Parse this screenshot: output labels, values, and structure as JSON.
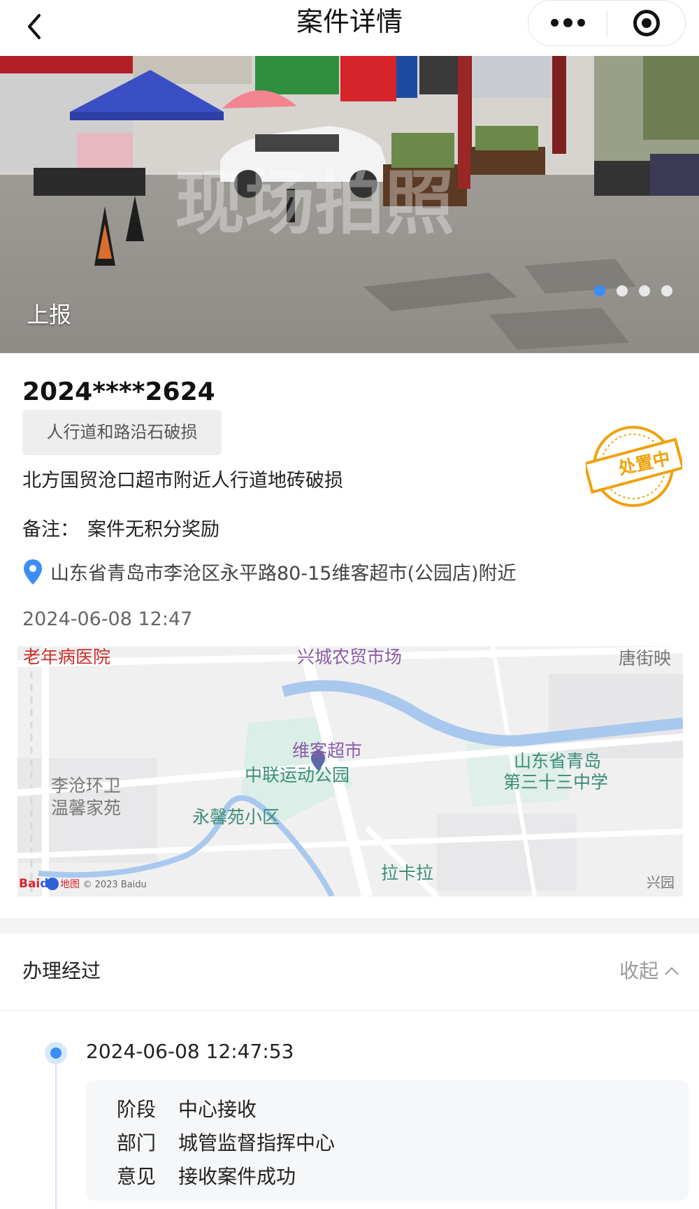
{
  "header": {
    "title": "案件详情",
    "back_icon": "chevron-left-icon",
    "more_icon": "more-dots-icon",
    "target_icon": "target-icon"
  },
  "photo": {
    "label": "上报",
    "watermark": "现场拍照",
    "slide_count": 4,
    "active_slide": 1
  },
  "case": {
    "id": "2024****2624",
    "category": "人行道和路沿石破损",
    "description": "北方国贸沧口超市附近人行道地砖破损",
    "remark_label": "备注：",
    "remark_value": "案件无积分奖励",
    "address": "山东省青岛市李沧区永平路80-15维客超市(公园店)附近",
    "time": "2024-06-08 12:47",
    "status_stamp": "处置中"
  },
  "map": {
    "labels": {
      "hospital": "老年病医院",
      "market": "兴城农贸市场",
      "tang": "唐街映",
      "weike": "维客超市",
      "park": "中联运动公园",
      "school_1": "山东省青岛",
      "school_2": "第三十三中学",
      "sanitation_1": "李沧环卫",
      "sanitation_2": "温馨家苑",
      "yongxin": "永馨苑小区",
      "lakala": "拉卡拉",
      "xingyuan": "兴园",
      "copyright": "© 2023 Baidu"
    }
  },
  "process": {
    "title": "办理经过",
    "collapse_label": "收起",
    "entries": [
      {
        "time": "2024-06-08 12:47:53",
        "stage_label": "阶段",
        "stage_value": "中心接收",
        "dept_label": "部门",
        "dept_value": "城管监督指挥中心",
        "opinion_label": "意见",
        "opinion_value": "接收案件成功"
      }
    ]
  },
  "colors": {
    "accent": "#3a8ef6",
    "stamp": "#f0a10c",
    "river": "#a9c8ee"
  }
}
